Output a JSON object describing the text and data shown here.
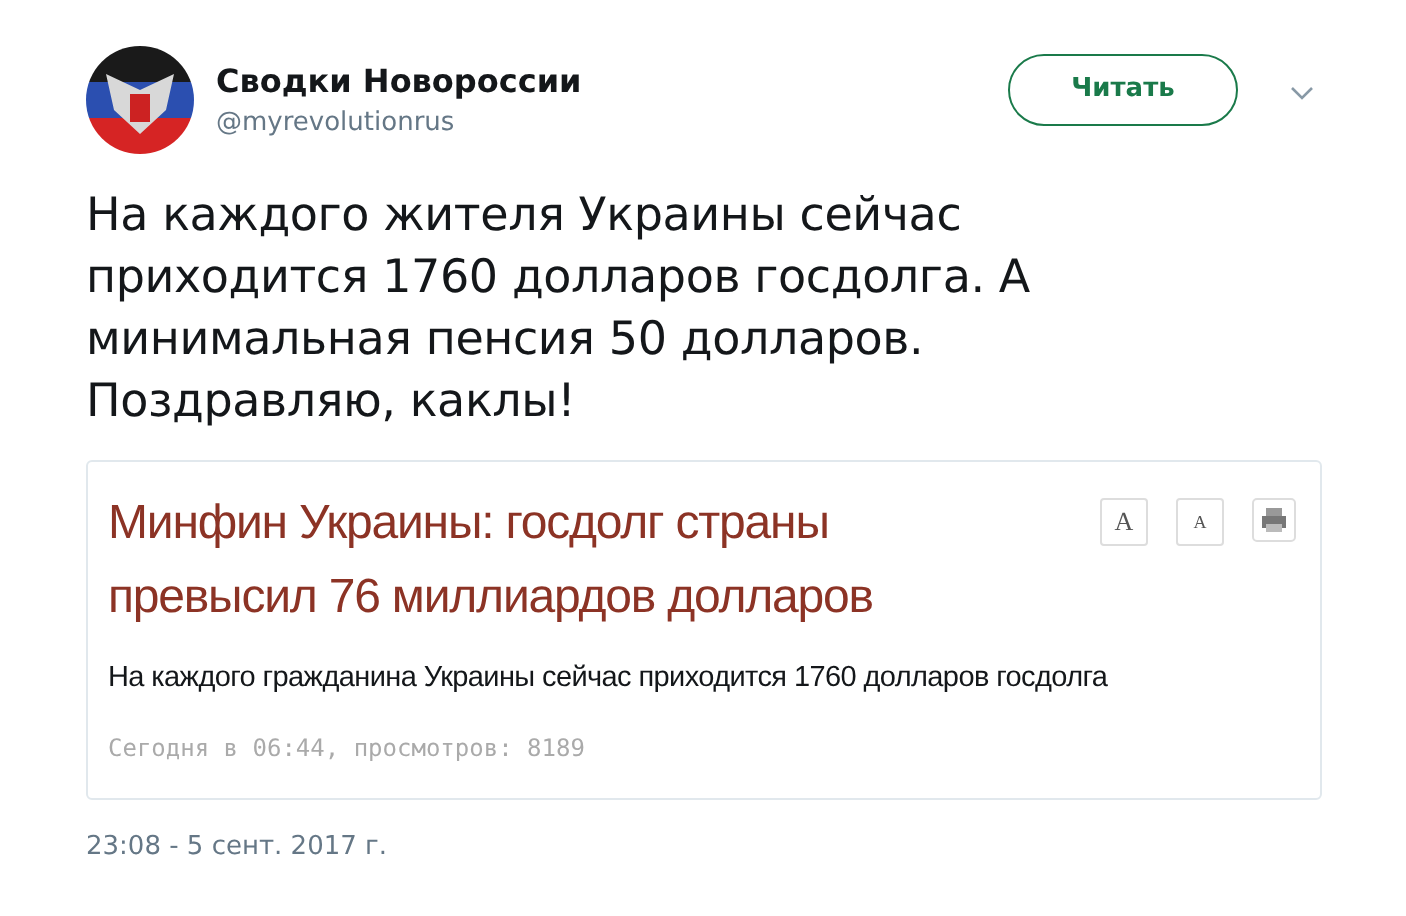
{
  "author": {
    "name": "Сводки Новороссии",
    "handle": "@myrevolutionrus"
  },
  "follow_button": "Читать",
  "tweet_text": "На каждого жителя Украины сейчас приходится 1760 долларов госдолга. А минимальная пенсия 50 долларов. Поздравляю, каклы!",
  "embedded_article": {
    "title": "Минфин Украины: госдолг страны превысил 76 миллиардов долларов",
    "tools": [
      {
        "kind": "font-up",
        "label": "A"
      },
      {
        "kind": "font-down",
        "label": "A"
      },
      {
        "kind": "print"
      }
    ],
    "lead": "На каждого гражданина Украины сейчас приходится 1760 долларов госдолга",
    "meta": "Сегодня в 06:44, просмотров: 8189"
  },
  "timestamp": "23:08 - 5 сент. 2017 г."
}
